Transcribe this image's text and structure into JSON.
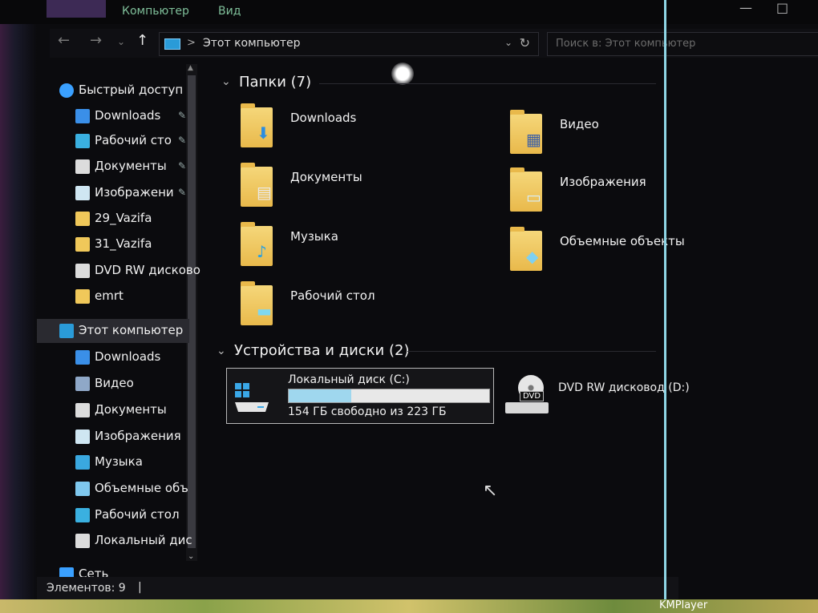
{
  "ribbon": {
    "tabs": [
      "Компьютер",
      "Вид"
    ]
  },
  "address": {
    "path": "Этот компьютер",
    "separator": ">"
  },
  "search": {
    "placeholder": "Поиск в: Этот компьютер"
  },
  "sidebar": {
    "items": [
      {
        "label": "Быстрый доступ",
        "icon": "star-icon",
        "color": "#3aa0ff",
        "pinned": false
      },
      {
        "label": "Downloads",
        "icon": "download-arrow-icon",
        "color": "#3a8fe8",
        "pinned": true
      },
      {
        "label": "Рабочий сто",
        "icon": "desktop-icon",
        "color": "#3ab0e0",
        "pinned": true
      },
      {
        "label": "Документы",
        "icon": "document-icon",
        "color": "#dcdcdc",
        "pinned": true
      },
      {
        "label": "Изображени",
        "icon": "image-icon",
        "color": "#cfe6f2",
        "pinned": true
      },
      {
        "label": "29_Vazifa",
        "icon": "folder-icon",
        "color": "#f0c85a",
        "pinned": false
      },
      {
        "label": "31_Vazifa",
        "icon": "folder-icon",
        "color": "#f0c85a",
        "pinned": false
      },
      {
        "label": "DVD RW дисково",
        "icon": "dvd-drive-icon",
        "color": "#dcdcdc",
        "pinned": false
      },
      {
        "label": "emrt",
        "icon": "folder-icon",
        "color": "#f0c85a",
        "pinned": false
      },
      {
        "label": "Этот компьютер",
        "icon": "computer-icon",
        "color": "#2a9bd8",
        "pinned": false,
        "selected": true
      },
      {
        "label": "Downloads",
        "icon": "download-arrow-icon",
        "color": "#3a8fe8",
        "pinned": false
      },
      {
        "label": "Видео",
        "icon": "video-icon",
        "color": "#8fa8c8",
        "pinned": false
      },
      {
        "label": "Документы",
        "icon": "document-icon",
        "color": "#dcdcdc",
        "pinned": false
      },
      {
        "label": "Изображения",
        "icon": "image-icon",
        "color": "#cfe6f2",
        "pinned": false
      },
      {
        "label": "Музыка",
        "icon": "music-note-icon",
        "color": "#3aa8e0",
        "pinned": false
      },
      {
        "label": "Объемные объ",
        "icon": "3d-objects-icon",
        "color": "#7fc8ee",
        "pinned": false
      },
      {
        "label": "Рабочий стол",
        "icon": "desktop-icon",
        "color": "#3ab0e0",
        "pinned": false
      },
      {
        "label": "Локальный дис",
        "icon": "local-disk-icon",
        "color": "#dcdcdc",
        "pinned": false
      },
      {
        "label": "Сеть",
        "icon": "network-icon",
        "color": "#3aa0ff",
        "pinned": false
      }
    ]
  },
  "main": {
    "folders_header": "Папки (7)",
    "folders": [
      {
        "label": "Downloads",
        "badge": "⬇",
        "badge_color": "#2a8de0"
      },
      {
        "label": "Видео",
        "badge": "▦",
        "badge_color": "#3a5fa8"
      },
      {
        "label": "Документы",
        "badge": "▤",
        "badge_color": "#eaeaea"
      },
      {
        "label": "Изображения",
        "badge": "▭",
        "badge_color": "#d8eef8"
      },
      {
        "label": "Музыка",
        "badge": "♪",
        "badge_color": "#2aa0e0"
      },
      {
        "label": "Объемные объекты",
        "badge": "◆",
        "badge_color": "#7fd0f0"
      },
      {
        "label": "Рабочий стол",
        "badge": "▬",
        "badge_color": "#7fd8f0"
      }
    ],
    "devices_header": "Устройства и диски (2)",
    "drive_c": {
      "name": "Локальный диск (C:)",
      "free_text": "154 ГБ свободно из 223 ГБ",
      "used_fraction": 0.31
    },
    "drive_d": {
      "name": "DVD RW дисковод (D:)",
      "tag": "DVD"
    }
  },
  "status": {
    "count": "Элементов: 9",
    "caret": "|"
  },
  "taskbar": {
    "label": "KMPlayer"
  }
}
